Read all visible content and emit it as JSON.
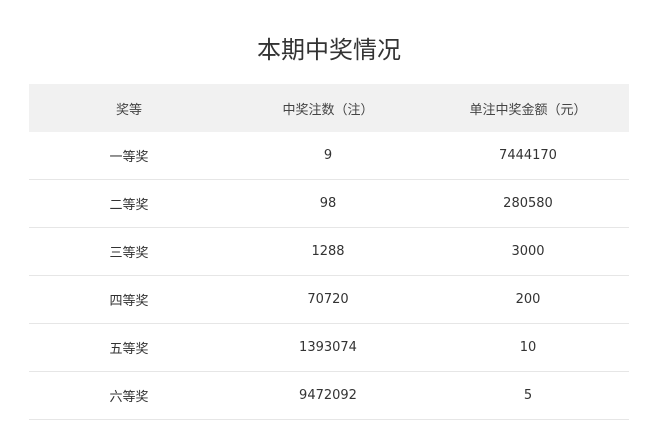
{
  "title": "本期中奖情况",
  "table": {
    "headers": [
      "奖等",
      "中奖注数（注）",
      "单注中奖金额（元）"
    ],
    "rows": [
      {
        "level": "一等奖",
        "count": "9",
        "amount": "7444170"
      },
      {
        "level": "二等奖",
        "count": "98",
        "amount": "280580"
      },
      {
        "level": "三等奖",
        "count": "1288",
        "amount": "3000"
      },
      {
        "level": "四等奖",
        "count": "70720",
        "amount": "200"
      },
      {
        "level": "五等奖",
        "count": "1393074",
        "amount": "10"
      },
      {
        "level": "六等奖",
        "count": "9472092",
        "amount": "5"
      }
    ]
  }
}
